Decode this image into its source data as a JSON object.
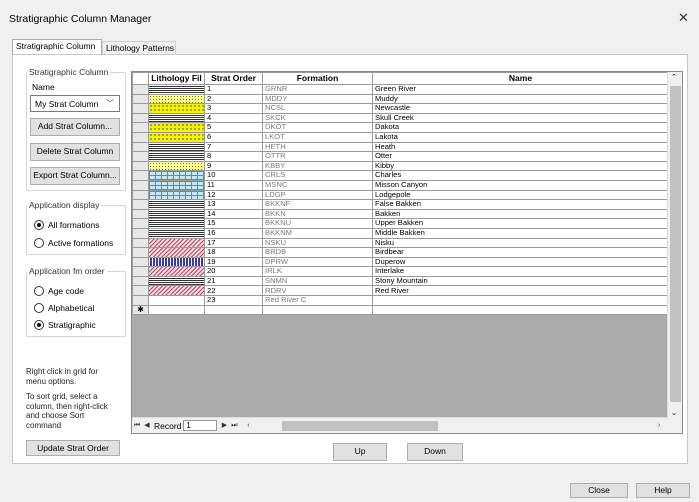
{
  "window": {
    "title": "Stratigraphic Column Manager"
  },
  "tabs": [
    {
      "label": "Stratigraphic Column"
    },
    {
      "label": "Lithology Patterns"
    }
  ],
  "left": {
    "strat_group_label": "Stratigraphic Column",
    "name_label": "Name",
    "selected_column": "My Strat Column",
    "add_button": "Add Strat Column...",
    "delete_button": "Delete Strat Column",
    "export_button": "Export Strat Column...",
    "display_group_label": "Application display",
    "display_options": [
      {
        "label": "All formations",
        "checked": true
      },
      {
        "label": "Active formations",
        "checked": false
      }
    ],
    "order_group_label": "Application fm order",
    "order_options": [
      {
        "label": "Age code",
        "checked": false
      },
      {
        "label": "Alphabetical",
        "checked": false
      },
      {
        "label": "Stratigraphic",
        "checked": true
      }
    ],
    "hint1": "Right click in grid for menu options.",
    "hint2": "To sort grid, select a column, then right-click and choose Sort command",
    "update_button": "Update Strat Order"
  },
  "grid": {
    "headers": [
      "Lithology Fil",
      "Strat Order",
      "Formation",
      "Name"
    ],
    "rows": [
      {
        "pattern": "lines",
        "order": "1",
        "formation": "GRNR",
        "name": "Green River"
      },
      {
        "pattern": "dots",
        "order": "2",
        "formation": "MDDY",
        "name": "Muddy"
      },
      {
        "pattern": "sand",
        "order": "3",
        "formation": "NCSL",
        "name": "Newcastle"
      },
      {
        "pattern": "lines",
        "order": "4",
        "formation": "SKCK",
        "name": "Skull Creek"
      },
      {
        "pattern": "sand",
        "order": "5",
        "formation": "DKOT",
        "name": "Dakota"
      },
      {
        "pattern": "sand",
        "order": "6",
        "formation": "LKOT",
        "name": "Lakota"
      },
      {
        "pattern": "lines",
        "order": "7",
        "formation": "HETH",
        "name": "Heath"
      },
      {
        "pattern": "lines",
        "order": "8",
        "formation": "OTTR",
        "name": "Otter"
      },
      {
        "pattern": "dots",
        "order": "9",
        "formation": "KBBY",
        "name": "Kibby"
      },
      {
        "pattern": "lime",
        "order": "10",
        "formation": "CRLS",
        "name": "Charles"
      },
      {
        "pattern": "lime",
        "order": "11",
        "formation": "MSNC",
        "name": "Misson Canyon"
      },
      {
        "pattern": "lime",
        "order": "12",
        "formation": "LDGP",
        "name": "Lodgepole"
      },
      {
        "pattern": "lines",
        "order": "13",
        "formation": "BKKNF",
        "name": "False Bakken"
      },
      {
        "pattern": "lines",
        "order": "14",
        "formation": "BKKN",
        "name": "Bakken"
      },
      {
        "pattern": "lines",
        "order": "15",
        "formation": "BKKNU",
        "name": "Upper Bakken"
      },
      {
        "pattern": "lines",
        "order": "16",
        "formation": "BKKNM",
        "name": "Middle Bakken"
      },
      {
        "pattern": "hatch",
        "order": "17",
        "formation": "NSKU",
        "name": "Nisku"
      },
      {
        "pattern": "hatch",
        "order": "18",
        "formation": "BRDB",
        "name": "Birdbear"
      },
      {
        "pattern": "blue",
        "order": "19",
        "formation": "DPRW",
        "name": "Duperow"
      },
      {
        "pattern": "hatch",
        "order": "20",
        "formation": "IRLK",
        "name": "Interlake"
      },
      {
        "pattern": "lines",
        "order": "21",
        "formation": "SNMN",
        "name": "Stony Mountain"
      },
      {
        "pattern": "hatch",
        "order": "22",
        "formation": "RDRV",
        "name": "Red River"
      },
      {
        "pattern": "",
        "order": "23",
        "formation": "Red River C",
        "name": ""
      }
    ],
    "new_row_marker": "✱",
    "record_label": "Record",
    "record_value": "1"
  },
  "buttons": {
    "up": "Up",
    "down": "Down",
    "close": "Close",
    "help": "Help"
  }
}
